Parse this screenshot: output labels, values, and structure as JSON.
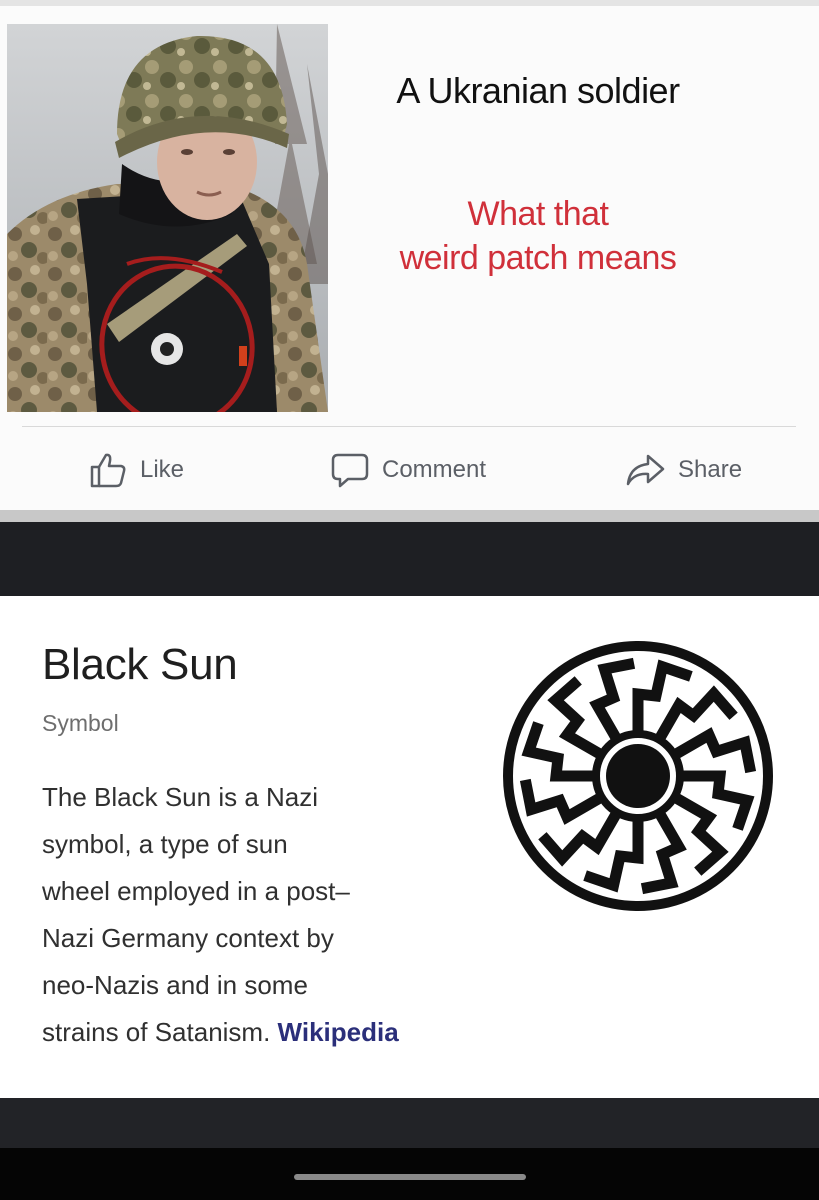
{
  "post": {
    "title": "A Ukranian soldier",
    "subtitle_lines": [
      "What that",
      "weird patch means"
    ],
    "actions": {
      "like_label": "Like",
      "comment_label": "Comment",
      "share_label": "Share"
    }
  },
  "knowledge_panel": {
    "title": "Black Sun",
    "subtitle": "Symbol",
    "description_lines": [
      "The Black Sun is a Nazi",
      "symbol, a type of sun",
      "wheel employed in a post–",
      "Nazi Germany context by",
      "neo-Nazis and in some",
      "strains of Satanism."
    ],
    "source_link": "Wikipedia"
  },
  "colors": {
    "accent_red": "#d0303a",
    "link": "#2b2f7a",
    "action_gray": "#5b5f66",
    "band_dark": "#1e1f23"
  },
  "icons": {
    "like": "thumbs-up-icon",
    "comment": "comment-bubble-icon",
    "share": "share-arrow-icon",
    "symbol": "black-sun-symbol"
  }
}
